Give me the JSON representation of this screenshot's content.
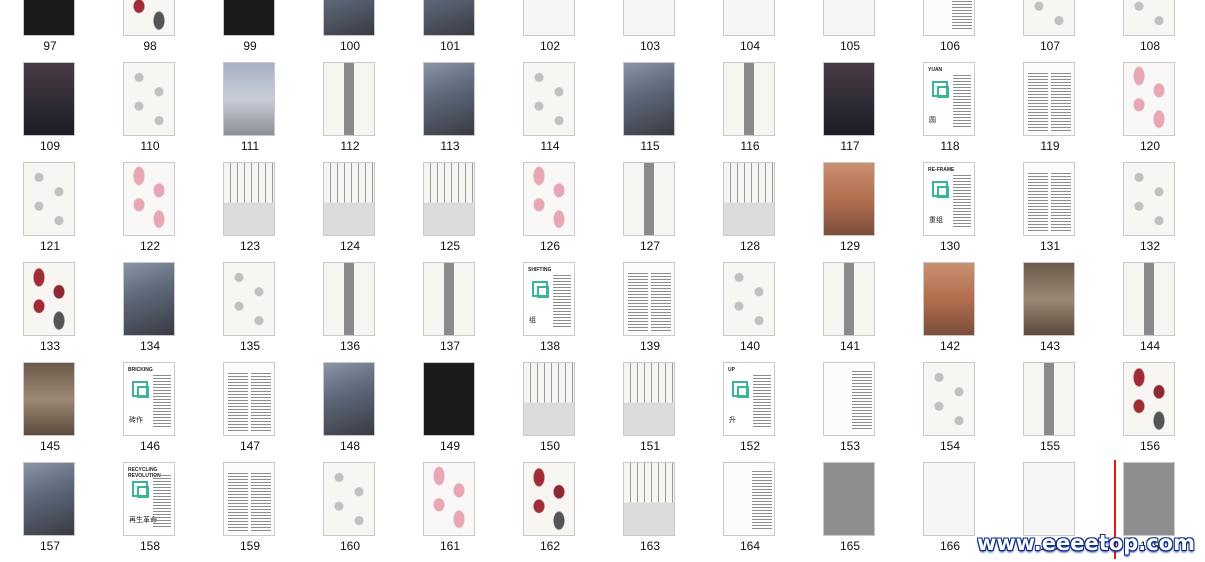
{
  "pages": [
    {
      "number": "97",
      "kind": "dark"
    },
    {
      "number": "98",
      "kind": "red"
    },
    {
      "number": "99",
      "kind": "dark"
    },
    {
      "number": "100",
      "kind": "photo"
    },
    {
      "number": "101",
      "kind": "photo"
    },
    {
      "number": "102",
      "kind": "light"
    },
    {
      "number": "103",
      "kind": "light"
    },
    {
      "number": "104",
      "kind": "light"
    },
    {
      "number": "105",
      "kind": "light"
    },
    {
      "number": "106",
      "kind": "text",
      "cn": "地面再生"
    },
    {
      "number": "107",
      "kind": "diagram"
    },
    {
      "number": "108",
      "kind": "diagram"
    },
    {
      "number": "109",
      "kind": "darkphoto"
    },
    {
      "number": "110",
      "kind": "diagram"
    },
    {
      "number": "111",
      "kind": "sky"
    },
    {
      "number": "112",
      "kind": "tower"
    },
    {
      "number": "113",
      "kind": "photo"
    },
    {
      "number": "114",
      "kind": "diagram"
    },
    {
      "number": "115",
      "kind": "photo"
    },
    {
      "number": "116",
      "kind": "tower"
    },
    {
      "number": "117",
      "kind": "darkphoto"
    },
    {
      "number": "118",
      "kind": "title",
      "title": "YUAN",
      "cn": "圆"
    },
    {
      "number": "119",
      "kind": "text2"
    },
    {
      "number": "120",
      "kind": "pink"
    },
    {
      "number": "121",
      "kind": "diagram"
    },
    {
      "number": "122",
      "kind": "pink"
    },
    {
      "number": "123",
      "kind": "section"
    },
    {
      "number": "124",
      "kind": "section"
    },
    {
      "number": "125",
      "kind": "section"
    },
    {
      "number": "126",
      "kind": "pink"
    },
    {
      "number": "127",
      "kind": "tower"
    },
    {
      "number": "128",
      "kind": "section"
    },
    {
      "number": "129",
      "kind": "brick"
    },
    {
      "number": "130",
      "kind": "title",
      "title": "RE-FRAME",
      "cn": "重组"
    },
    {
      "number": "131",
      "kind": "text2"
    },
    {
      "number": "132",
      "kind": "diagram"
    },
    {
      "number": "133",
      "kind": "red"
    },
    {
      "number": "134",
      "kind": "photo"
    },
    {
      "number": "135",
      "kind": "diagram"
    },
    {
      "number": "136",
      "kind": "tower"
    },
    {
      "number": "137",
      "kind": "tower"
    },
    {
      "number": "138",
      "kind": "title",
      "title": "SHIFTING",
      "cn": "组"
    },
    {
      "number": "139",
      "kind": "text2"
    },
    {
      "number": "140",
      "kind": "diagram"
    },
    {
      "number": "141",
      "kind": "tower"
    },
    {
      "number": "142",
      "kind": "brick"
    },
    {
      "number": "143",
      "kind": "interior"
    },
    {
      "number": "144",
      "kind": "tower"
    },
    {
      "number": "145",
      "kind": "interior"
    },
    {
      "number": "146",
      "kind": "title",
      "title": "BRICKING",
      "cn": "砖作"
    },
    {
      "number": "147",
      "kind": "text2"
    },
    {
      "number": "148",
      "kind": "photo"
    },
    {
      "number": "149",
      "kind": "dark"
    },
    {
      "number": "150",
      "kind": "section"
    },
    {
      "number": "151",
      "kind": "section"
    },
    {
      "number": "152",
      "kind": "title",
      "title": "UP",
      "cn": "升"
    },
    {
      "number": "153",
      "kind": "text"
    },
    {
      "number": "154",
      "kind": "diagram"
    },
    {
      "number": "155",
      "kind": "tower"
    },
    {
      "number": "156",
      "kind": "red"
    },
    {
      "number": "157",
      "kind": "photo"
    },
    {
      "number": "158",
      "kind": "title",
      "title": "RECYCLING REVOLUTION",
      "cn": "再生革命"
    },
    {
      "number": "159",
      "kind": "text2"
    },
    {
      "number": "160",
      "kind": "diagram"
    },
    {
      "number": "161",
      "kind": "pink"
    },
    {
      "number": "162",
      "kind": "red"
    },
    {
      "number": "163",
      "kind": "section"
    },
    {
      "number": "164",
      "kind": "text"
    },
    {
      "number": "165",
      "kind": "gray"
    },
    {
      "number": "166",
      "kind": "light"
    },
    {
      "number": "167",
      "kind": "light"
    },
    {
      "number": "168",
      "kind": "gray"
    }
  ],
  "watermark": "www.eeeetop.com",
  "accent_color": "#3cb49a"
}
